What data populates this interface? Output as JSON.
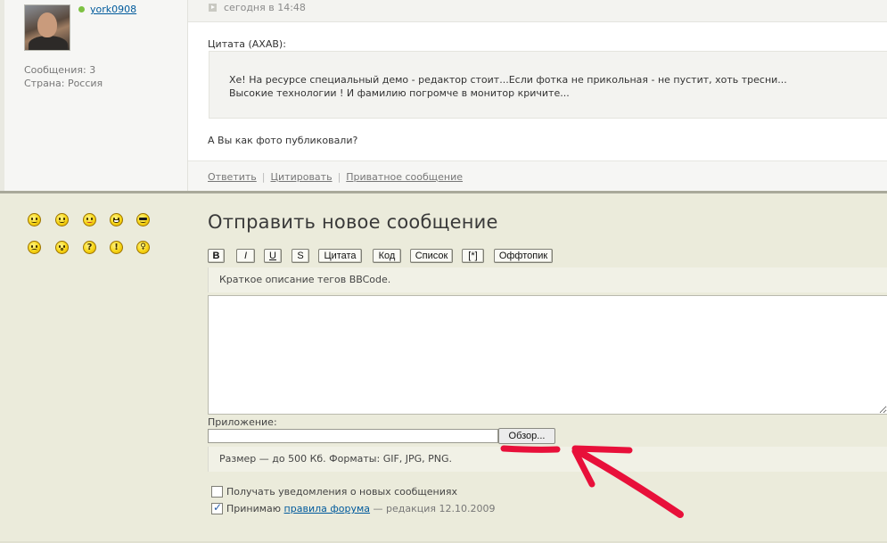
{
  "post": {
    "author": {
      "username": "york0908",
      "messages": "Сообщения: 3",
      "country": "Страна: Россия"
    },
    "date": "сегодня в 14:48",
    "quote_label": "Цитата (AXAB):",
    "quote_lines": [
      "Хе! На ресурсе специальный демо - редактор стоит...Если фотка не прикольная - не пустит, хоть тресни...",
      "Высокие технологии ! И фамилию погромче в монитор кричите..."
    ],
    "message": "А Вы как фото публиковали?",
    "actions": {
      "reply": "Ответить",
      "quote": "Цитировать",
      "private": "Приватное сообщение",
      "separator": "|"
    }
  },
  "smilies": [
    "smile-icon",
    "happy-icon",
    "tongue-icon",
    "grin-icon",
    "cool-icon",
    "sad-icon",
    "surprised-icon",
    "question-icon",
    "exclamation-icon",
    "idea-icon"
  ],
  "reply_form": {
    "title": "Отправить новое сообщение",
    "toolbar": {
      "bold": "B",
      "italic": "I",
      "underline": "U",
      "strike": "S",
      "quote": "Цитата",
      "code": "Код",
      "list": "Список",
      "list_item": "[*]",
      "offtopic": "Оффтопик"
    },
    "bbcode_hint": "Краткое описание тегов BBCode.",
    "message_value": "",
    "attachment_label": "Приложение:",
    "attachment_value": "",
    "browse_button": "Обзор...",
    "size_hint": "Размер — до 500 Кб. Форматы: GIF, JPG, PNG.",
    "notify": {
      "label": "Получать уведомления о новых сообщениях",
      "checked": false
    },
    "rules": {
      "prefix": "Принимаю ",
      "link": "правила форума",
      "suffix": " — редакция 12.10.2009",
      "checked": true
    }
  },
  "colors": {
    "annotation_red": "#e8103a",
    "link_blue": "#005a9c",
    "form_background": "#ebebdb",
    "online_green": "#7dc142"
  }
}
